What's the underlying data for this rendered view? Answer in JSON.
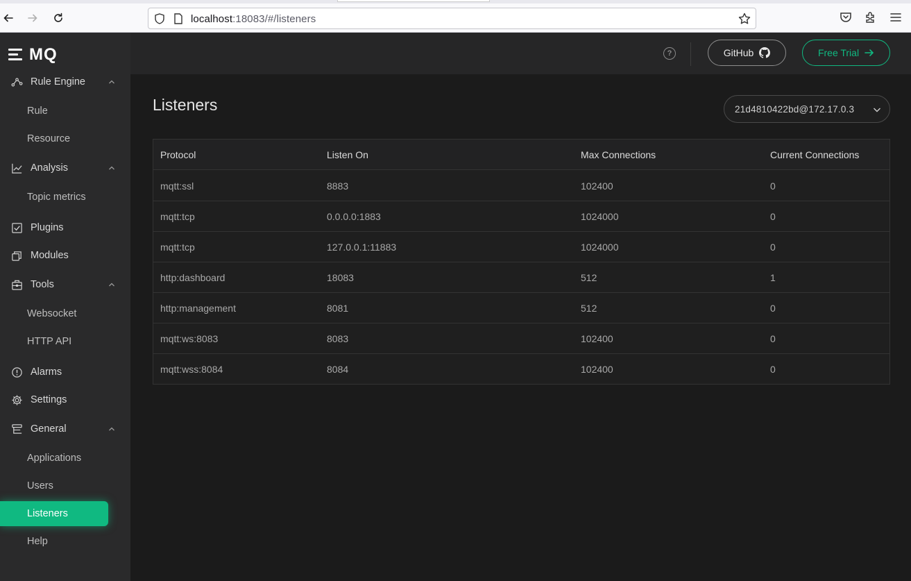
{
  "browser": {
    "url_host": "localhost",
    "url_rest": ":18083/#/listeners"
  },
  "sidebar": {
    "logo": "MQ",
    "items": [
      {
        "type": "group",
        "label": "Rule Engine",
        "icon": "rule-engine-icon"
      },
      {
        "type": "sub",
        "label": "Rule"
      },
      {
        "type": "sub",
        "label": "Resource"
      },
      {
        "type": "group",
        "label": "Analysis",
        "icon": "analysis-icon"
      },
      {
        "type": "sub",
        "label": "Topic metrics"
      },
      {
        "type": "item",
        "label": "Plugins",
        "icon": "plugins-icon"
      },
      {
        "type": "item",
        "label": "Modules",
        "icon": "modules-icon"
      },
      {
        "type": "group",
        "label": "Tools",
        "icon": "tools-icon"
      },
      {
        "type": "sub",
        "label": "Websocket"
      },
      {
        "type": "sub",
        "label": "HTTP API"
      },
      {
        "type": "item",
        "label": "Alarms",
        "icon": "alarms-icon"
      },
      {
        "type": "item",
        "label": "Settings",
        "icon": "settings-icon"
      },
      {
        "type": "group",
        "label": "General",
        "icon": "general-icon"
      },
      {
        "type": "sub",
        "label": "Applications"
      },
      {
        "type": "sub",
        "label": "Users"
      },
      {
        "type": "sub",
        "label": "Listeners",
        "active": true
      },
      {
        "type": "sub",
        "label": "Help"
      }
    ]
  },
  "header": {
    "github_label": "GitHub",
    "trial_label": "Free Trial",
    "help_glyph": "?"
  },
  "main": {
    "title": "Listeners",
    "node_select": "21d4810422bd@172.17.0.3",
    "table": {
      "columns": [
        "Protocol",
        "Listen On",
        "Max Connections",
        "Current Connections"
      ],
      "rows": [
        [
          "mqtt:ssl",
          "8883",
          "102400",
          "0"
        ],
        [
          "mqtt:tcp",
          "0.0.0.0:1883",
          "1024000",
          "0"
        ],
        [
          "mqtt:tcp",
          "127.0.0.1:11883",
          "1024000",
          "0"
        ],
        [
          "http:dashboard",
          "18083",
          "512",
          "1"
        ],
        [
          "http:management",
          "8081",
          "512",
          "0"
        ],
        [
          "mqtt:ws:8083",
          "8083",
          "102400",
          "0"
        ],
        [
          "mqtt:wss:8084",
          "8084",
          "102400",
          "0"
        ]
      ]
    }
  },
  "colors": {
    "accent": "#10b981",
    "sidebar_bg": "#2a2a2b",
    "page_bg": "#1b1b1b"
  }
}
